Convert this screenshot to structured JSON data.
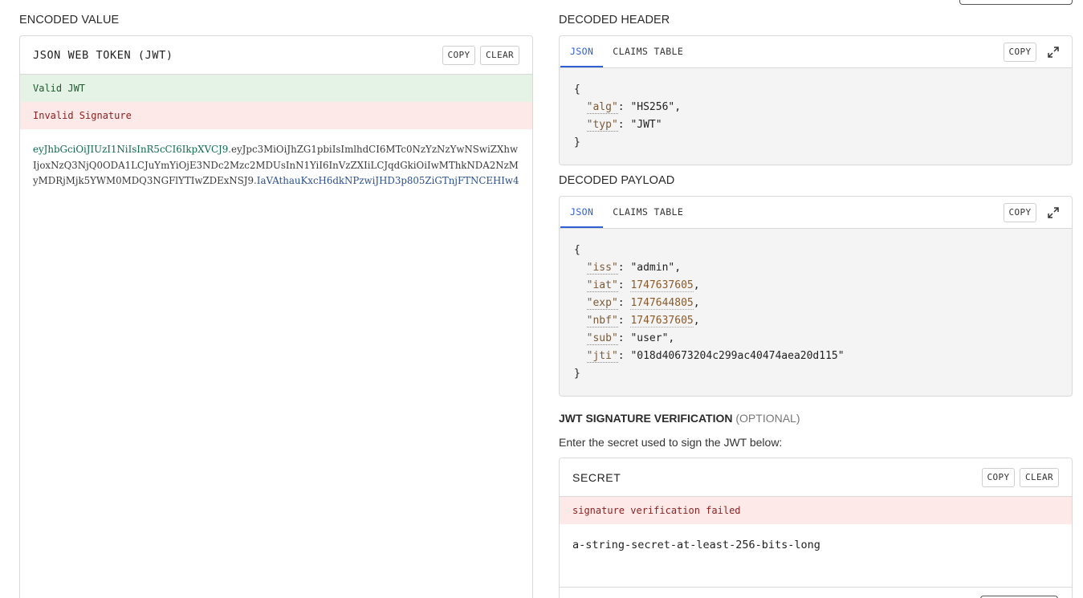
{
  "encoded": {
    "section_title": "ENCODED VALUE",
    "panel_title": "JSON WEB TOKEN (JWT)",
    "copy_label": "COPY",
    "clear_label": "CLEAR",
    "status_valid": "Valid JWT",
    "status_signature": "Invalid Signature",
    "token_header": "eyJhbGciOiJIUzI1NiIsInR5cCI6IkpXVCJ9",
    "token_payload": "eyJpc3MiOiJhZG1pbiIsImlhdCI6MTc0NzYzNzYwNSwiZXhwIjoxNzQ3NjQ0ODA1LCJuYmYiOjE3NDc2Mzc2MDUsInN1YiI6InVzZXIiLCJqdGkiOiIwMThkNDA2NzMyMDRjMjk5YWM0MDQ3NGFlYTIwZDExNSJ9",
    "token_signature": "IaVAthauKxcH6dkNPzwiJHD3p805ZiGTnjFTNCEHIw4",
    "dot": "."
  },
  "decoded_header": {
    "section_title": "DECODED HEADER",
    "tab_json": "JSON",
    "tab_claims": "CLAIMS TABLE",
    "copy_label": "COPY",
    "open_brace": "{",
    "close_brace": "}",
    "lines": [
      {
        "key": "\"alg\"",
        "value": "\"HS256\"",
        "comma": ","
      },
      {
        "key": "\"typ\"",
        "value": "\"JWT\"",
        "comma": ""
      }
    ]
  },
  "decoded_payload": {
    "section_title": "DECODED PAYLOAD",
    "tab_json": "JSON",
    "tab_claims": "CLAIMS TABLE",
    "copy_label": "COPY",
    "open_brace": "{",
    "close_brace": "}",
    "lines": [
      {
        "key": "\"iss\"",
        "value": "\"admin\"",
        "comma": ","
      },
      {
        "key": "\"iat\"",
        "value": "1747637605",
        "comma": ","
      },
      {
        "key": "\"exp\"",
        "value": "1747644805",
        "comma": ","
      },
      {
        "key": "\"nbf\"",
        "value": "1747637605",
        "comma": ","
      },
      {
        "key": "\"sub\"",
        "value": "\"user\"",
        "comma": ","
      },
      {
        "key": "\"jti\"",
        "value": "\"018d40673204c299ac40474aea20d115\"",
        "comma": ""
      }
    ]
  },
  "signature": {
    "title": "JWT SIGNATURE VERIFICATION",
    "optional": "(OPTIONAL)",
    "description": "Enter the secret used to sign the JWT below:",
    "panel_title": "SECRET",
    "copy_label": "COPY",
    "clear_label": "CLEAR",
    "status": "signature verification failed",
    "secret_value": "a-string-secret-at-least-256-bits-long"
  },
  "colon": ": "
}
